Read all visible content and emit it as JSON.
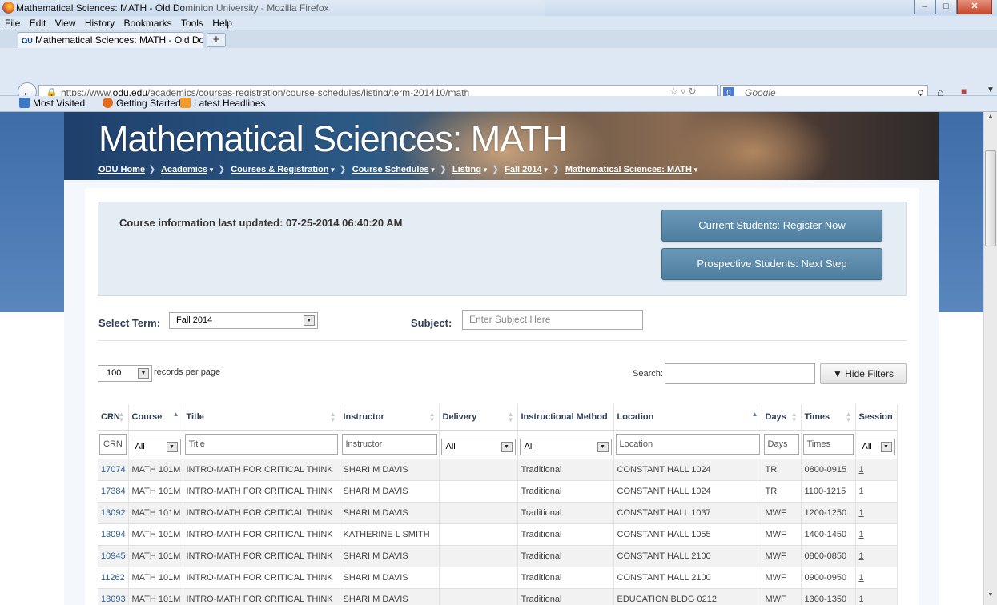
{
  "browser": {
    "window_title": "Mathematical Sciences: MATH - Old Dominion University - Mozilla Firefox",
    "menu": [
      "File",
      "Edit",
      "View",
      "History",
      "Bookmarks",
      "Tools",
      "Help"
    ],
    "tab_title": "Mathematical Sciences: MATH - Old Do...",
    "new_tab": "+",
    "url_prefix": "https://www.",
    "url_domain": "odu.edu",
    "url_path": "/academics/courses-registration/course-schedules/listing/term-201410/math",
    "search_placeholder": "Google",
    "bookmarks": [
      "Most Visited",
      "Getting Started",
      "Latest Headlines"
    ]
  },
  "page": {
    "heading": "Mathematical Sciences: MATH",
    "breadcrumbs": [
      "ODU Home",
      "Academics",
      "Courses & Registration",
      "Course Schedules",
      "Listing",
      "Fall 2014",
      "Mathematical Sciences: MATH"
    ],
    "updated_text": "Course information last updated: 07-25-2014 06:40:20 AM",
    "cta_register": "Current Students: Register Now",
    "cta_prospective": "Prospective Students: Next Step",
    "term_label": "Select Term:",
    "term_value": "Fall 2014",
    "subject_label": "Subject:",
    "subject_placeholder": "Enter Subject Here",
    "rpp_value": "100",
    "rpp_label": "records per page",
    "search_label": "Search:",
    "hide_filters": "Hide Filters"
  },
  "table": {
    "columns": [
      "CRN",
      "Course",
      "Title",
      "Instructor",
      "Delivery",
      "Instructional Method",
      "Location",
      "Days",
      "Times",
      "Session"
    ],
    "filters": {
      "crn": "CRN",
      "course": "All",
      "title": "Title",
      "instructor": "Instructor",
      "delivery": "All",
      "method": "All",
      "location": "Location",
      "days": "Days",
      "times": "Times",
      "session": "All"
    },
    "rows": [
      {
        "crn": "17074",
        "course": "MATH 101M",
        "title": "INTRO-MATH FOR CRITICAL THINK",
        "instructor": "SHARI M DAVIS",
        "delivery": "",
        "method": "Traditional",
        "location": "CONSTANT HALL 1024",
        "days": "TR",
        "times": "0800-0915",
        "session": "1"
      },
      {
        "crn": "17384",
        "course": "MATH 101M",
        "title": "INTRO-MATH FOR CRITICAL THINK",
        "instructor": "SHARI M DAVIS",
        "delivery": "",
        "method": "Traditional",
        "location": "CONSTANT HALL 1024",
        "days": "TR",
        "times": "1100-1215",
        "session": "1"
      },
      {
        "crn": "13092",
        "course": "MATH 101M",
        "title": "INTRO-MATH FOR CRITICAL THINK",
        "instructor": "SHARI M DAVIS",
        "delivery": "",
        "method": "Traditional",
        "location": "CONSTANT HALL 1037",
        "days": "MWF",
        "times": "1200-1250",
        "session": "1"
      },
      {
        "crn": "13094",
        "course": "MATH 101M",
        "title": "INTRO-MATH FOR CRITICAL THINK",
        "instructor": "KATHERINE L SMITH",
        "delivery": "",
        "method": "Traditional",
        "location": "CONSTANT HALL 1055",
        "days": "MWF",
        "times": "1400-1450",
        "session": "1"
      },
      {
        "crn": "10945",
        "course": "MATH 101M",
        "title": "INTRO-MATH FOR CRITICAL THINK",
        "instructor": "SHARI M DAVIS",
        "delivery": "",
        "method": "Traditional",
        "location": "CONSTANT HALL 2100",
        "days": "MWF",
        "times": "0800-0850",
        "session": "1"
      },
      {
        "crn": "11262",
        "course": "MATH 101M",
        "title": "INTRO-MATH FOR CRITICAL THINK",
        "instructor": "SHARI M DAVIS",
        "delivery": "",
        "method": "Traditional",
        "location": "CONSTANT HALL 2100",
        "days": "MWF",
        "times": "0900-0950",
        "session": "1"
      },
      {
        "crn": "13093",
        "course": "MATH 101M",
        "title": "INTRO-MATH FOR CRITICAL THINK",
        "instructor": "SHARI M DAVIS",
        "delivery": "",
        "method": "Traditional",
        "location": "EDUCATION BLDG 0212",
        "days": "MWF",
        "times": "1300-1350",
        "session": "1"
      }
    ]
  },
  "colors": {
    "accent": "#4e7e9f",
    "header_band": "#4977b2",
    "link": "#2c5e8f"
  },
  "icons": [
    "firefox-logo-icon",
    "minimize-icon",
    "maximize-icon",
    "close-icon",
    "back-arrow-icon",
    "lock-icon",
    "bookmark-star-icon",
    "reload-icon",
    "google-icon",
    "search-icon",
    "home-icon",
    "funnel-icon",
    "sort-arrows-icon"
  ]
}
